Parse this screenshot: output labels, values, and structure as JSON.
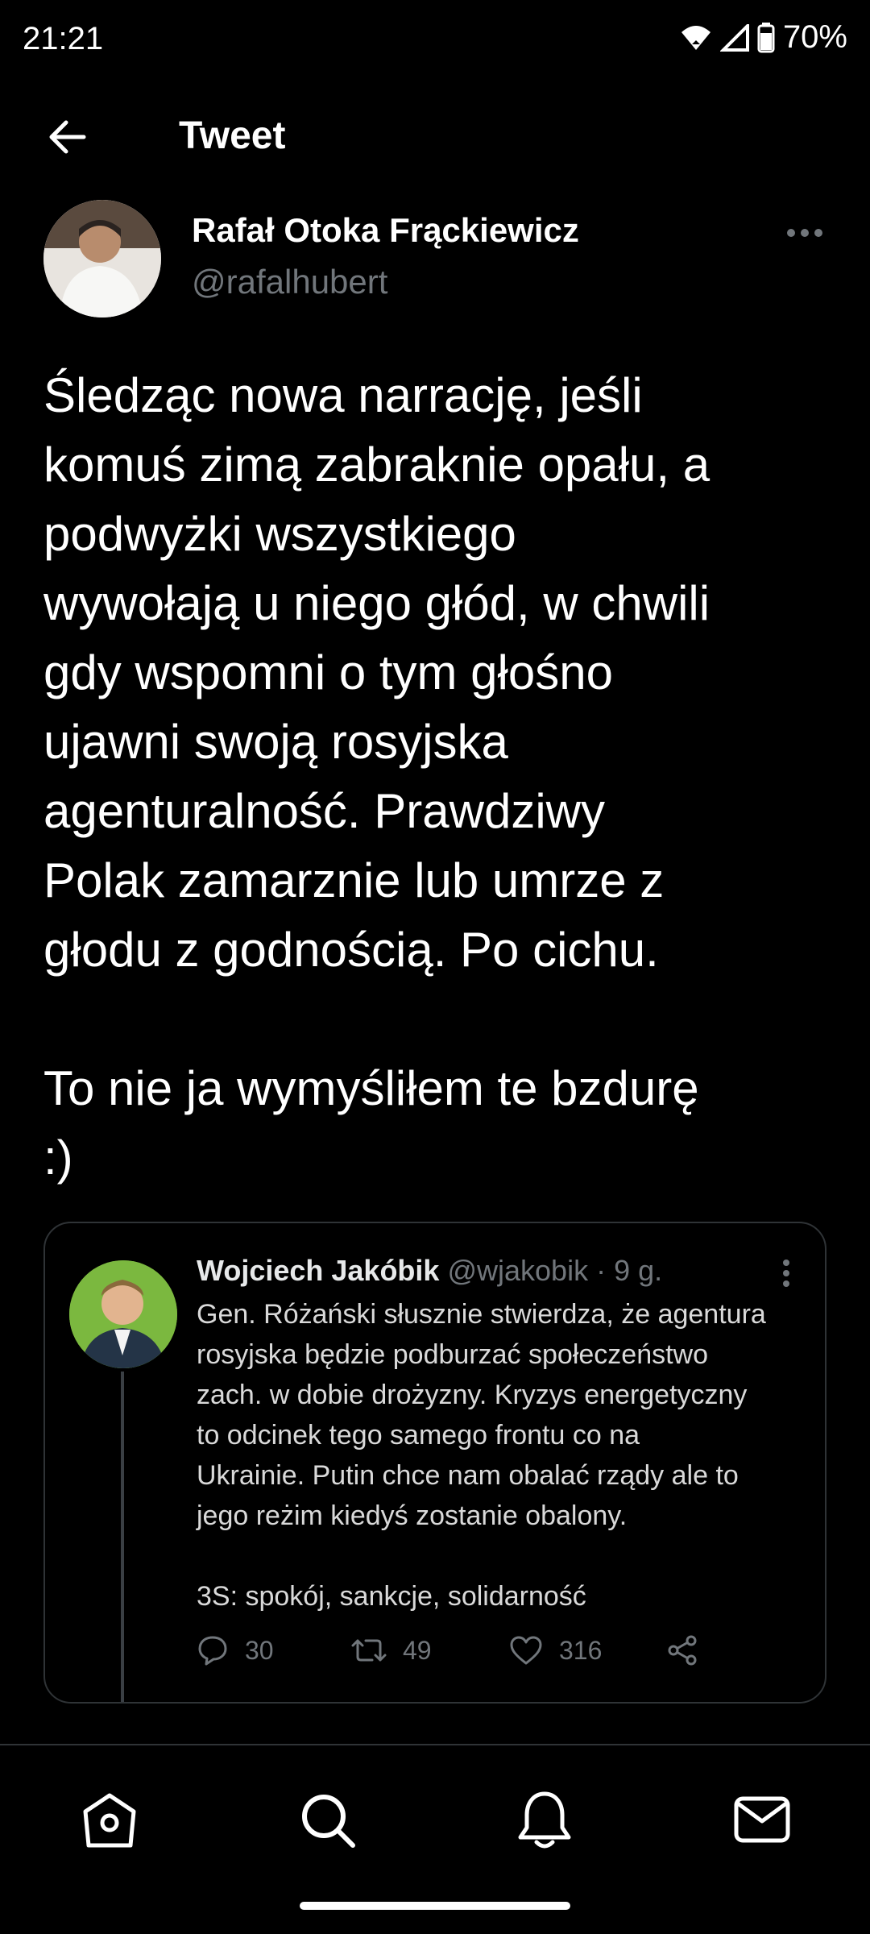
{
  "status_bar": {
    "time": "21:21",
    "battery": "70%"
  },
  "header": {
    "title": "Tweet"
  },
  "tweet": {
    "author_name": "Rafał Otoka Frąckiewicz",
    "author_handle": "@rafalhubert",
    "text": "Śledząc nowa narrację, jeśli\nkomuś zimą zabraknie opału, a\npodwyżki wszystkiego\nwywołają u niego głód, w chwili\ngdy wspomni o tym głośno\nujawni swoją rosyjska\nagenturalność. Prawdziwy\nPolak zamarznie lub umrze z\ngłodu z godnością. Po cichu.\n\nTo nie ja wymyśliłem te bzdurę\n:)"
  },
  "quoted_tweet": {
    "author_name": "Wojciech Jakóbik",
    "author_handle": "@wjakobik",
    "time": "· 9 g.",
    "text": "Gen. Różański słusznie stwierdza, że agentura\nrosyjska będzie podburzać społeczeństwo\nzach. w dobie drożyzny. Kryzys energetyczny\nto odcinek tego samego frontu co na\nUkrainie. Putin chce nam obalać rządy ale to\njego reżim kiedyś zostanie obalony.\n\n3S: spokój, sankcje, solidarność",
    "replies": "30",
    "retweets": "49",
    "likes": "316"
  },
  "icons": {
    "back": "arrow-left-icon",
    "more": "more-horizontal-icon",
    "reply": "reply-icon",
    "retweet": "retweet-icon",
    "like": "heart-icon",
    "share": "share-icon",
    "nav": [
      "home-icon",
      "search-icon",
      "bell-icon",
      "mail-icon"
    ]
  },
  "colors": {
    "background": "#000000",
    "secondary_text": "#71767b",
    "border": "#2f3336"
  }
}
